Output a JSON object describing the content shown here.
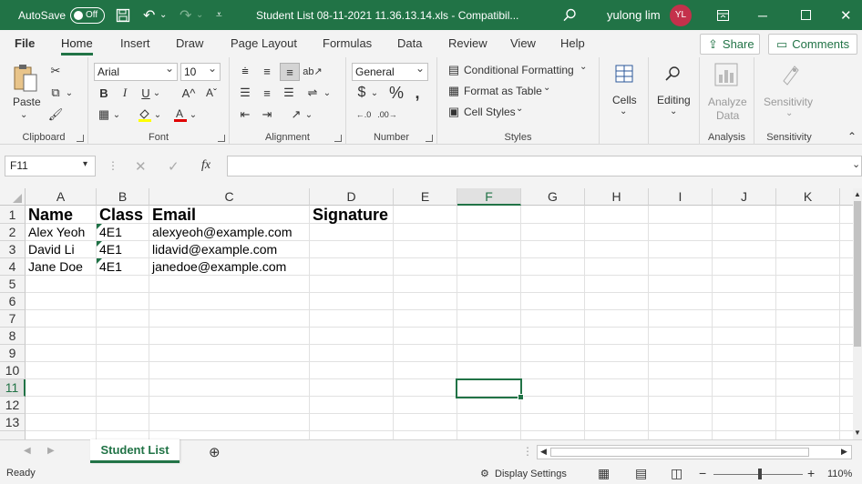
{
  "titlebar": {
    "autosave_label": "AutoSave",
    "autosave_state": "Off",
    "title": "Student List 08-11-2021 11.36.13.14.xls  -  Compatibil...",
    "user_name": "yulong lim",
    "user_initials": "YL"
  },
  "menu": {
    "tabs": [
      "File",
      "Home",
      "Insert",
      "Draw",
      "Page Layout",
      "Formulas",
      "Data",
      "Review",
      "View",
      "Help"
    ],
    "active": "Home",
    "share_label": "Share",
    "comments_label": "Comments"
  },
  "ribbon": {
    "clipboard": {
      "label": "Clipboard",
      "paste": "Paste"
    },
    "font": {
      "label": "Font",
      "name": "Arial",
      "size": "10"
    },
    "alignment": {
      "label": "Alignment"
    },
    "number": {
      "label": "Number",
      "format": "General"
    },
    "styles": {
      "label": "Styles",
      "conditional": "Conditional Formatting",
      "format_table": "Format as Table",
      "cell_styles": "Cell Styles"
    },
    "cells": {
      "label": "Cells"
    },
    "editing": {
      "label": "Editing"
    },
    "analysis": {
      "label": "Analysis",
      "btn_line1": "Analyze",
      "btn_line2": "Data"
    },
    "sensitivity": {
      "label": "Sensitivity",
      "btn": "Sensitivity"
    }
  },
  "formula": {
    "namebox": "F11",
    "fx": "fx",
    "value": ""
  },
  "grid": {
    "columns": [
      "A",
      "B",
      "C",
      "D",
      "E",
      "F",
      "G",
      "H",
      "I",
      "J",
      "K"
    ],
    "rows": [
      "1",
      "2",
      "3",
      "4",
      "5",
      "6",
      "7",
      "8",
      "9",
      "10",
      "11",
      "12",
      "13"
    ],
    "header": {
      "name": "Name",
      "class": "Class",
      "email": "Email",
      "signature": "Signature"
    },
    "students": [
      {
        "name": "Alex Yeoh",
        "class": "4E1",
        "email": "alexyeoh@example.com"
      },
      {
        "name": "David Li",
        "class": "4E1",
        "email": "lidavid@example.com"
      },
      {
        "name": "Jane Doe",
        "class": "4E1",
        "email": "janedoe@example.com"
      }
    ],
    "selected_cell": "F11"
  },
  "sheets": {
    "active": "Student List"
  },
  "status": {
    "ready": "Ready",
    "display_settings": "Display Settings",
    "zoom": "110%"
  },
  "colors": {
    "accent": "#217346",
    "avatar": "#c4314b"
  }
}
